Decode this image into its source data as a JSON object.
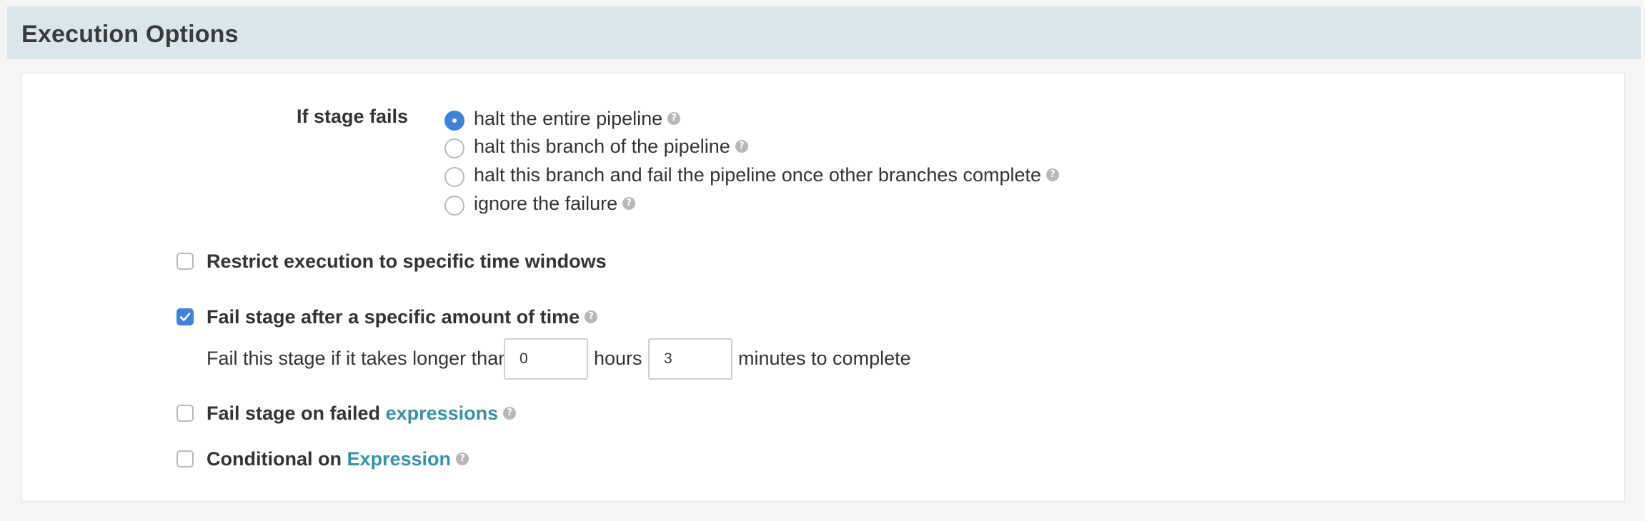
{
  "section": {
    "title": "Execution Options"
  },
  "stage_failure": {
    "label": "If stage fails",
    "options": [
      {
        "label": "halt the entire pipeline",
        "selected": true
      },
      {
        "label": "halt this branch of the pipeline",
        "selected": false
      },
      {
        "label": "halt this branch and fail the pipeline once other branches complete",
        "selected": false
      },
      {
        "label": "ignore the failure",
        "selected": false
      }
    ],
    "help_icon": "?"
  },
  "restrict_time": {
    "label": "Restrict execution to specific time windows",
    "checked": false
  },
  "fail_after_time": {
    "label": "Fail stage after a specific amount of time",
    "checked": true,
    "text_before": "Fail this stage if it takes longer than",
    "hours_value": "0",
    "hours_label": "hours",
    "minutes_value": "3",
    "minutes_label": "minutes to complete"
  },
  "fail_on_expressions": {
    "label_prefix": "Fail stage on failed",
    "link": "expressions",
    "checked": false
  },
  "conditional": {
    "label_prefix": "Conditional on",
    "link": "Expression",
    "checked": false
  },
  "colors": {
    "accent": "#3b82e0",
    "link": "#3792a7",
    "header_bg": "#d9e6ec"
  },
  "icons": {
    "help": "question-circle-icon",
    "check": "checkmark-icon"
  }
}
